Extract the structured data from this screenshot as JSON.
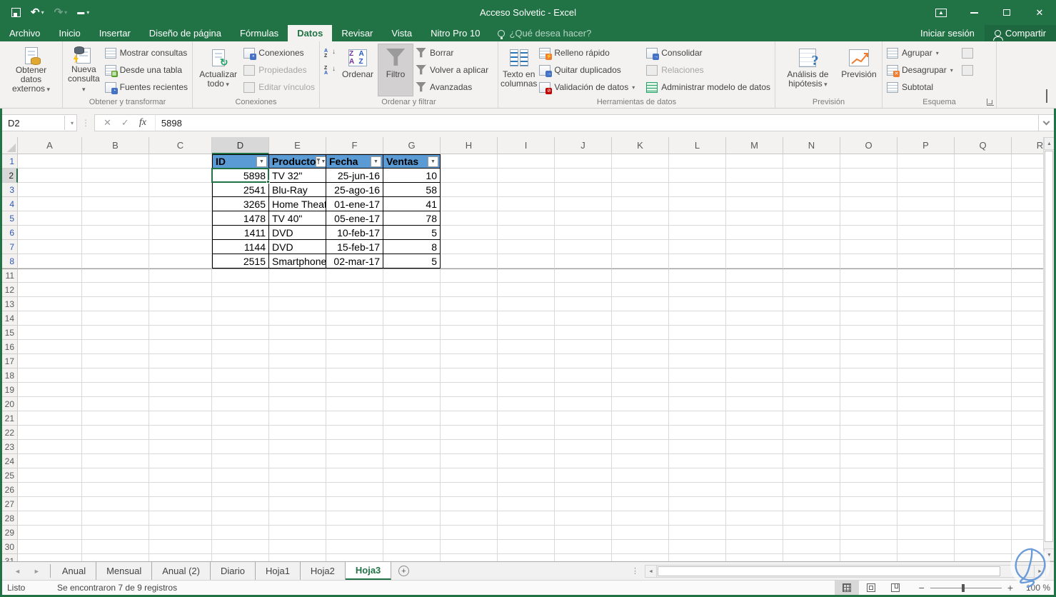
{
  "colors": {
    "accent_green": "#217346",
    "table_header_blue": "#5B9BD5",
    "filtered_row_number_blue": "#2F55B4",
    "selection_green": "#217346"
  },
  "titlebar": {
    "title": "Acceso Solvetic - Excel"
  },
  "tabs": {
    "items": [
      "Archivo",
      "Inicio",
      "Insertar",
      "Diseño de página",
      "Fórmulas",
      "Datos",
      "Revisar",
      "Vista",
      "Nitro Pro 10"
    ],
    "active": "Datos",
    "tell_me": "¿Qué desea hacer?",
    "sign_in": "Iniciar sesión",
    "share": "Compartir"
  },
  "ribbon": {
    "g0": {
      "label": "",
      "big": "Obtener datos externos"
    },
    "g1": {
      "label": "Obtener y transformar",
      "big": "Nueva consulta",
      "items": [
        "Mostrar consultas",
        "Desde una tabla",
        "Fuentes recientes"
      ]
    },
    "g2": {
      "label": "Conexiones",
      "big": "Actualizar todo",
      "items": [
        "Conexiones",
        "Propiedades",
        "Editar vínculos"
      ]
    },
    "g3": {
      "label": "Ordenar y filtrar",
      "big_sort": "Ordenar",
      "big_filter": "Filtro",
      "items": [
        "Borrar",
        "Volver a aplicar",
        "Avanzadas"
      ]
    },
    "g4": {
      "label": "Herramientas de datos",
      "big": "Texto en columnas",
      "items": [
        "Relleno rápido",
        "Quitar duplicados",
        "Validación de datos"
      ],
      "items2": [
        "Consolidar",
        "Relaciones",
        "Administrar modelo de datos"
      ]
    },
    "g5": {
      "label": "Previsión",
      "big1": "Análisis de hipótesis",
      "big2": "Previsión"
    },
    "g6": {
      "label": "Esquema",
      "items": [
        "Agrupar",
        "Desagrupar",
        "Subtotal"
      ]
    }
  },
  "formula_bar": {
    "name_box": "D2",
    "fx": "fx",
    "value": "5898"
  },
  "grid": {
    "columns": [
      "A",
      "B",
      "C",
      "D",
      "E",
      "F",
      "G",
      "H",
      "I",
      "J",
      "K",
      "L",
      "M",
      "N",
      "O",
      "P",
      "Q",
      "R"
    ],
    "selected_cell": "D2",
    "selected_column": "D",
    "selected_row": 2,
    "row_numbers_visible": [
      1,
      2,
      3,
      4,
      5,
      6,
      7,
      8,
      11,
      12,
      13,
      14,
      15,
      16,
      17,
      18,
      19,
      20,
      21,
      22,
      23,
      24,
      25,
      26,
      27,
      28,
      29,
      30,
      31
    ],
    "filtered_blue_rows": [
      1,
      2,
      3,
      4,
      5,
      6,
      7,
      8
    ],
    "table": {
      "start_column": "D",
      "headers": [
        {
          "label": "ID",
          "filter": "dropdown"
        },
        {
          "label": "Producto",
          "filter": "applied"
        },
        {
          "label": "Fecha",
          "filter": "dropdown"
        },
        {
          "label": "Ventas",
          "filter": "dropdown"
        }
      ],
      "rows": [
        {
          "ID": "5898",
          "Producto": "TV 32\"",
          "Fecha": "25-jun-16",
          "Ventas": "10"
        },
        {
          "ID": "2541",
          "Producto": "Blu-Ray",
          "Fecha": "25-ago-16",
          "Ventas": "58"
        },
        {
          "ID": "3265",
          "Producto": "Home Theater",
          "Fecha": "01-ene-17",
          "Ventas": "41"
        },
        {
          "ID": "1478",
          "Producto": "TV 40\"",
          "Fecha": "05-ene-17",
          "Ventas": "78"
        },
        {
          "ID": "1411",
          "Producto": "DVD",
          "Fecha": "10-feb-17",
          "Ventas": "5"
        },
        {
          "ID": "1144",
          "Producto": "DVD",
          "Fecha": "15-feb-17",
          "Ventas": "8"
        },
        {
          "ID": "2515",
          "Producto": "Smartphone",
          "Fecha": "02-mar-17",
          "Ventas": "5"
        }
      ]
    }
  },
  "sheetbar": {
    "sheets": [
      "Anual",
      "Mensual",
      "Anual (2)",
      "Diario",
      "Hoja1",
      "Hoja2",
      "Hoja3"
    ],
    "active": "Hoja3",
    "add_label": "+"
  },
  "statusbar": {
    "mode": "Listo",
    "message": "Se encontraron 7 de 9 registros",
    "zoom_level": "100 %"
  }
}
